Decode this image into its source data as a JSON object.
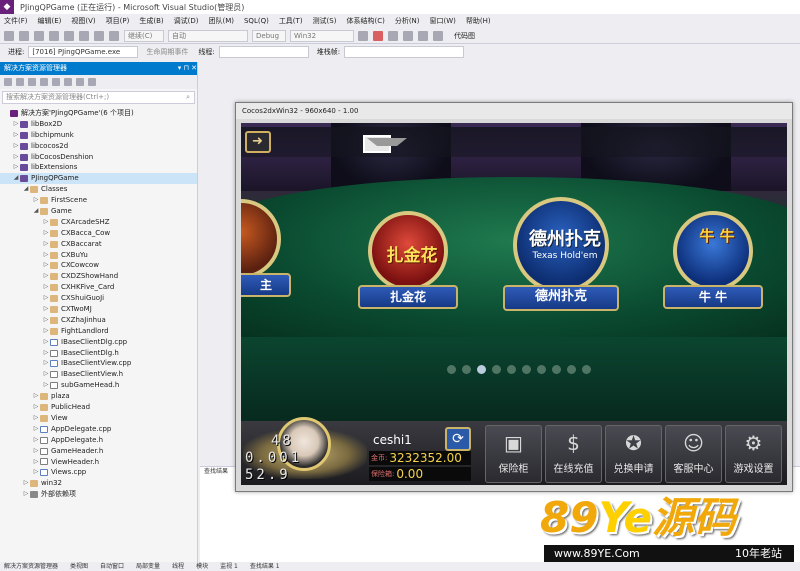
{
  "window": {
    "title": "PJingQPGame (正在运行) - Microsoft Visual Studio(管理员)"
  },
  "menu": [
    "文件(F)",
    "编辑(E)",
    "视图(V)",
    "项目(P)",
    "生成(B)",
    "调试(D)",
    "团队(M)",
    "SQL(Q)",
    "工具(T)",
    "测试(S)",
    "体系结构(C)",
    "分析(N)",
    "窗口(W)",
    "帮助(H)"
  ],
  "toolbar": {
    "continue": "继续(C)",
    "mode": "自动",
    "config": "Debug",
    "platform": "Win32",
    "code_map": "代码图"
  },
  "toolbar2": {
    "process_label": "进程:",
    "process_value": "[7016] PJingQPGame.exe",
    "lifecycle_label": "生命周期事件",
    "thread_label": "线程:",
    "stack_label": "堆栈帧:"
  },
  "solution": {
    "title": "解决方案资源管理器",
    "search_placeholder": "搜索解决方案资源管理器(Ctrl+;)",
    "items": [
      {
        "label": "解决方案'PJingQPGame'(6 个项目)",
        "indent": 0,
        "arrow": "",
        "icon": "sol"
      },
      {
        "label": "libBox2D",
        "indent": 1,
        "arrow": "▷",
        "icon": "proj"
      },
      {
        "label": "libchipmunk",
        "indent": 1,
        "arrow": "▷",
        "icon": "proj"
      },
      {
        "label": "libcocos2d",
        "indent": 1,
        "arrow": "▷",
        "icon": "proj"
      },
      {
        "label": "libCocosDenshion",
        "indent": 1,
        "arrow": "▷",
        "icon": "proj"
      },
      {
        "label": "libExtensions",
        "indent": 1,
        "arrow": "▷",
        "icon": "proj"
      },
      {
        "label": "PJingQPGame",
        "indent": 1,
        "arrow": "◢",
        "icon": "proj",
        "selected": true
      },
      {
        "label": "Classes",
        "indent": 2,
        "arrow": "◢",
        "icon": "folder"
      },
      {
        "label": "FirstScene",
        "indent": 3,
        "arrow": "▷",
        "icon": "folder"
      },
      {
        "label": "Game",
        "indent": 3,
        "arrow": "◢",
        "icon": "folder"
      },
      {
        "label": "CXArcadeSHZ",
        "indent": 4,
        "arrow": "▷",
        "icon": "folder"
      },
      {
        "label": "CXBacca_Cow",
        "indent": 4,
        "arrow": "▷",
        "icon": "folder"
      },
      {
        "label": "CXBaccarat",
        "indent": 4,
        "arrow": "▷",
        "icon": "folder"
      },
      {
        "label": "CXBuYu",
        "indent": 4,
        "arrow": "▷",
        "icon": "folder"
      },
      {
        "label": "CXCowcow",
        "indent": 4,
        "arrow": "▷",
        "icon": "folder"
      },
      {
        "label": "CXDZShowHand",
        "indent": 4,
        "arrow": "▷",
        "icon": "folder"
      },
      {
        "label": "CXHKFive_Card",
        "indent": 4,
        "arrow": "▷",
        "icon": "folder"
      },
      {
        "label": "CXShuiGuoJi",
        "indent": 4,
        "arrow": "▷",
        "icon": "folder"
      },
      {
        "label": "CXTwoMJ",
        "indent": 4,
        "arrow": "▷",
        "icon": "folder"
      },
      {
        "label": "CXZhaJinhua",
        "indent": 4,
        "arrow": "▷",
        "icon": "folder"
      },
      {
        "label": "FightLandlord",
        "indent": 4,
        "arrow": "▷",
        "icon": "folder"
      },
      {
        "label": "IBaseClientDlg.cpp",
        "indent": 4,
        "arrow": "▷",
        "icon": "cpp"
      },
      {
        "label": "IBaseClientDlg.h",
        "indent": 4,
        "arrow": "▷",
        "icon": "file"
      },
      {
        "label": "IBaseClientView.cpp",
        "indent": 4,
        "arrow": "▷",
        "icon": "cpp"
      },
      {
        "label": "IBaseClientView.h",
        "indent": 4,
        "arrow": "▷",
        "icon": "file"
      },
      {
        "label": "subGameHead.h",
        "indent": 4,
        "arrow": "▷",
        "icon": "file"
      },
      {
        "label": "plaza",
        "indent": 3,
        "arrow": "▷",
        "icon": "folder"
      },
      {
        "label": "PublicHead",
        "indent": 3,
        "arrow": "▷",
        "icon": "folder"
      },
      {
        "label": "View",
        "indent": 3,
        "arrow": "▷",
        "icon": "folder"
      },
      {
        "label": "AppDelegate.cpp",
        "indent": 3,
        "arrow": "▷",
        "icon": "cpp"
      },
      {
        "label": "AppDelegate.h",
        "indent": 3,
        "arrow": "▷",
        "icon": "file"
      },
      {
        "label": "GameHeader.h",
        "indent": 3,
        "arrow": "▷",
        "icon": "file"
      },
      {
        "label": "ViewHeader.h",
        "indent": 3,
        "arrow": "▷",
        "icon": "file"
      },
      {
        "label": "Views.cpp",
        "indent": 3,
        "arrow": "▷",
        "icon": "cpp"
      },
      {
        "label": "win32",
        "indent": 2,
        "arrow": "▷",
        "icon": "folder"
      },
      {
        "label": "外部依赖项",
        "indent": 2,
        "arrow": "▷",
        "icon": "ref"
      }
    ]
  },
  "find_panel": {
    "title": "查找结果"
  },
  "status_tabs": [
    "解决方案资源管理器",
    "类视图",
    "自动窗口",
    "局部变量",
    "线程",
    "模块",
    "监视 1",
    "查找结果 1"
  ],
  "cocos": {
    "title": "Cocos2dxWin32 - 960x640 - 1.00",
    "tiles": [
      {
        "name": "扎金花",
        "sub": ""
      },
      {
        "name": "德州扑克",
        "sub": "Texas Hold'em",
        "ribbon": "德州扑克"
      },
      {
        "name": "牛 牛",
        "sub": "",
        "ribbon": "牛  牛"
      }
    ],
    "left_tile_ribbon": "主",
    "dots_total": 10,
    "dots_active": 2,
    "fps": [
      "48",
      "0.001",
      "52.9"
    ],
    "user": {
      "name": "ceshi1",
      "coins_label": "金币:",
      "coins": "3232352.00",
      "bank_label": "保险箱:",
      "bank": "0.00"
    },
    "menu": [
      {
        "icon": "wallet-icon",
        "glyph": "▣",
        "label": "保险柜"
      },
      {
        "icon": "money-icon",
        "glyph": "$",
        "label": "在线充值"
      },
      {
        "icon": "chip-icon",
        "glyph": "✪",
        "label": "兑换申请"
      },
      {
        "icon": "agent-icon",
        "glyph": "☺",
        "label": "客服中心"
      },
      {
        "icon": "gear-icon",
        "glyph": "⚙",
        "label": "游戏设置"
      }
    ]
  },
  "watermark": {
    "brand_a": "89",
    "brand_b": "Ye",
    "brand_c": "源码",
    "url": "www.89YE.Com",
    "tagline": "10年老站"
  }
}
